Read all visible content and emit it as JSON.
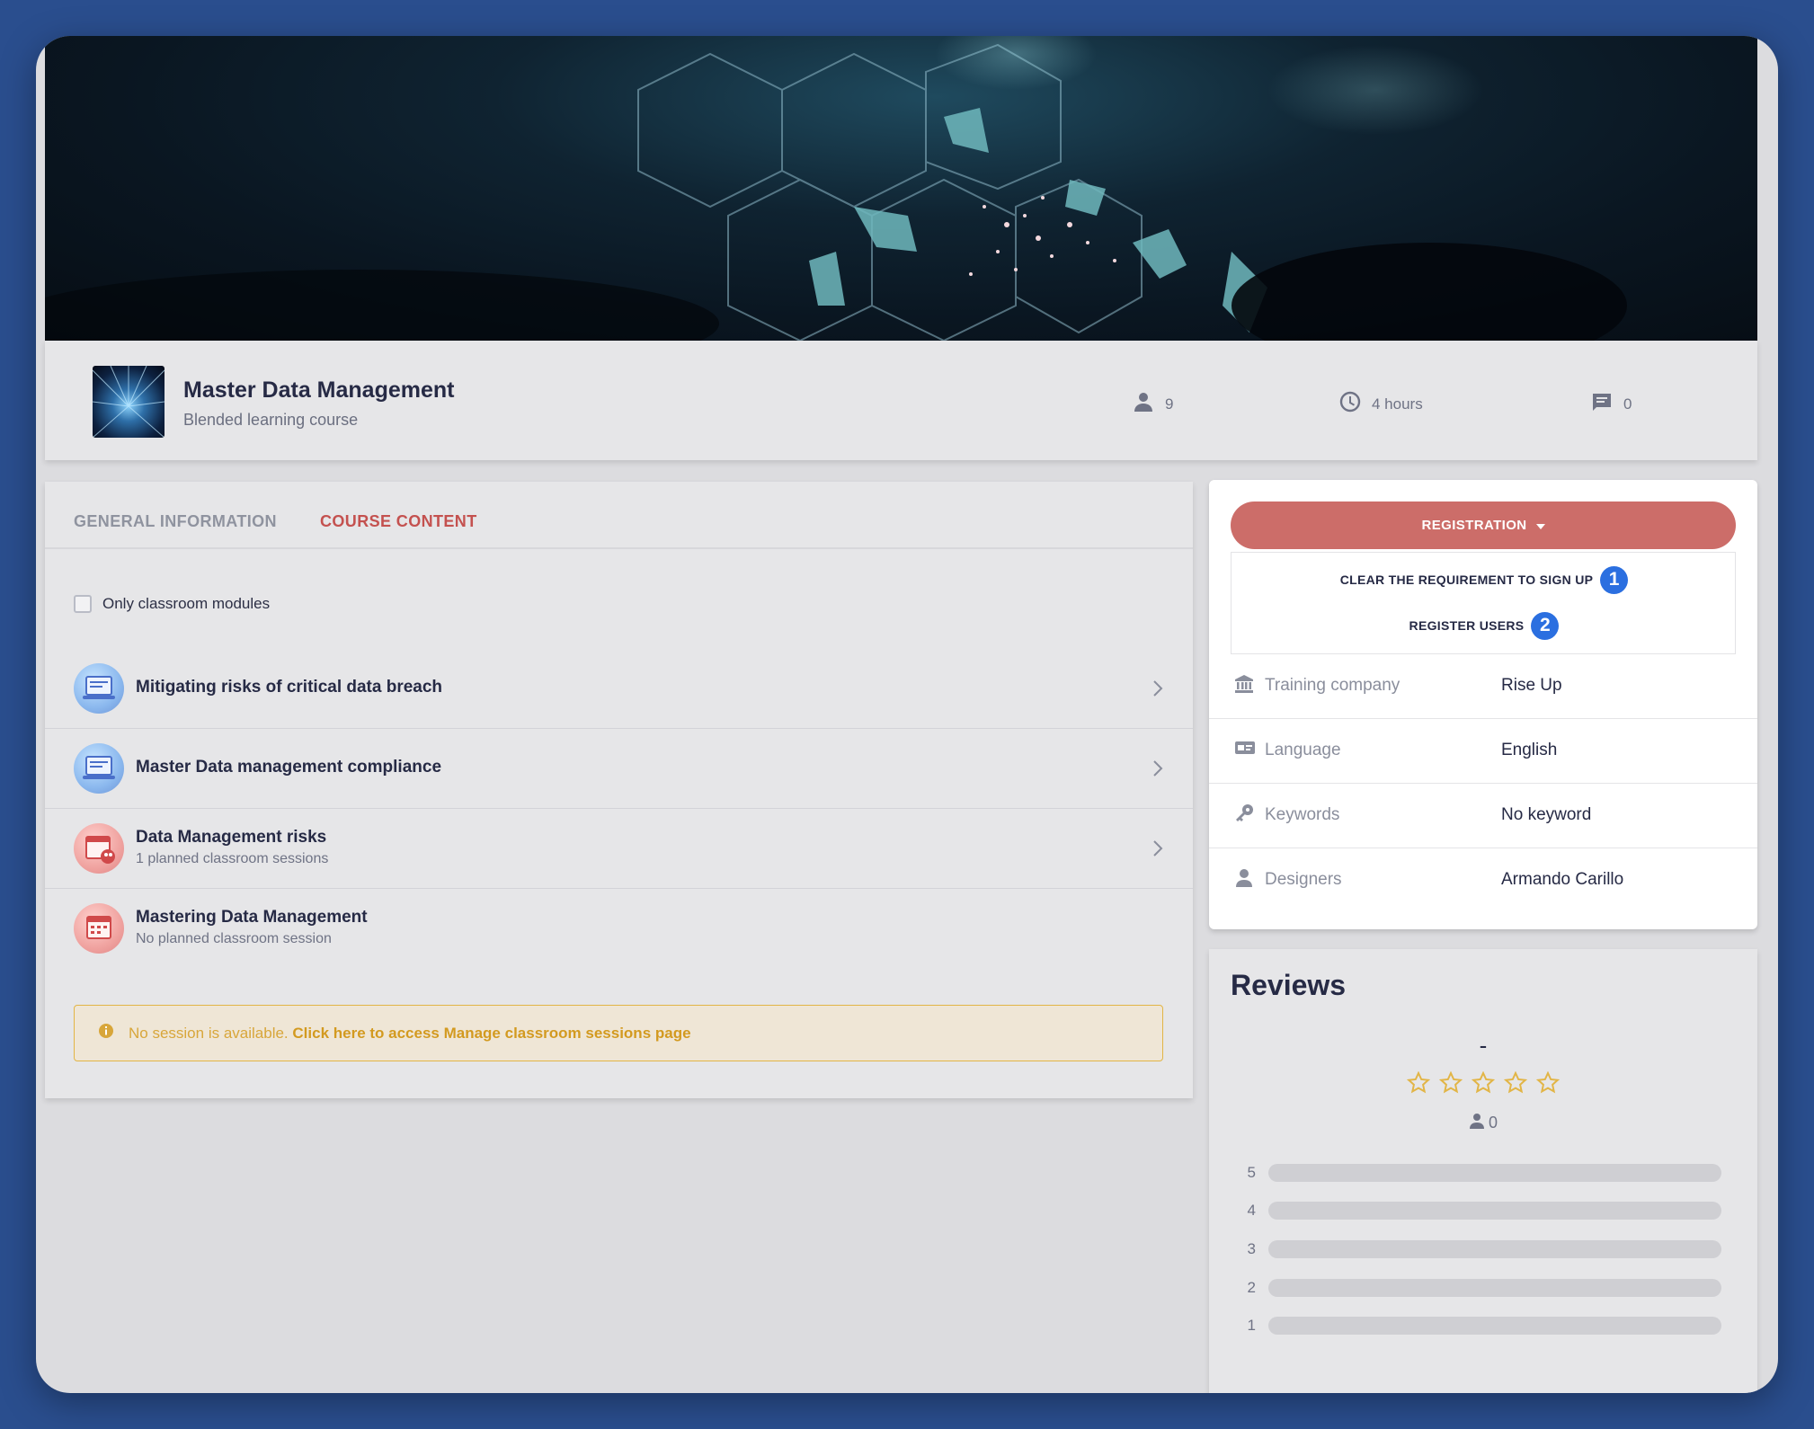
{
  "course": {
    "title": "Master Data Management",
    "subtitle": "Blended learning course",
    "learners": "9",
    "duration": "4 hours",
    "comments": "0"
  },
  "tabs": [
    {
      "label": "GENERAL INFORMATION",
      "active": false
    },
    {
      "label": "COURSE CONTENT",
      "active": true
    }
  ],
  "filter": {
    "label": "Only classroom modules",
    "checked": false
  },
  "modules": [
    {
      "title": "Mitigating risks of critical data breach",
      "subtitle": "",
      "type": "elearning-icon"
    },
    {
      "title": "Master Data management compliance",
      "subtitle": "",
      "type": "elearning-icon"
    },
    {
      "title": "Data Management risks",
      "subtitle": "1 planned classroom sessions",
      "type": "classroom-icon"
    },
    {
      "title": "Mastering Data Management",
      "subtitle": "No planned classroom session",
      "type": "calendar-icon"
    }
  ],
  "alert": {
    "text": "No session is available.",
    "link": "Click here to access Manage classroom sessions page"
  },
  "registration": {
    "button_label": "REGISTRATION",
    "items": [
      {
        "label": "CLEAR THE REQUIREMENT TO SIGN UP",
        "badge": "1"
      },
      {
        "label": "REGISTER USERS",
        "badge": "2"
      }
    ]
  },
  "info": [
    {
      "label": "Training company",
      "value": "Rise Up",
      "icon": "bank-icon"
    },
    {
      "label": "Language",
      "value": "English",
      "icon": "language-card-icon"
    },
    {
      "label": "Keywords",
      "value": "No keyword",
      "icon": "key-icon"
    },
    {
      "label": "Designers",
      "value": "Armando Carillo",
      "icon": "person-icon"
    }
  ],
  "reviews": {
    "title": "Reviews",
    "average": "-",
    "count": "0",
    "stars_filled": 0,
    "distribution": [
      {
        "label": "5",
        "fraction": 0
      },
      {
        "label": "4",
        "fraction": 0
      },
      {
        "label": "3",
        "fraction": 0
      },
      {
        "label": "2",
        "fraction": 0
      },
      {
        "label": "1",
        "fraction": 0
      }
    ]
  },
  "colors": {
    "accent_red": "#c4514f",
    "registration_button": "#cc6d69",
    "badge_blue": "#2b6fe0",
    "alert_border": "#e2b546",
    "star": "#e2b546",
    "page_background": "#2a4e8e"
  }
}
